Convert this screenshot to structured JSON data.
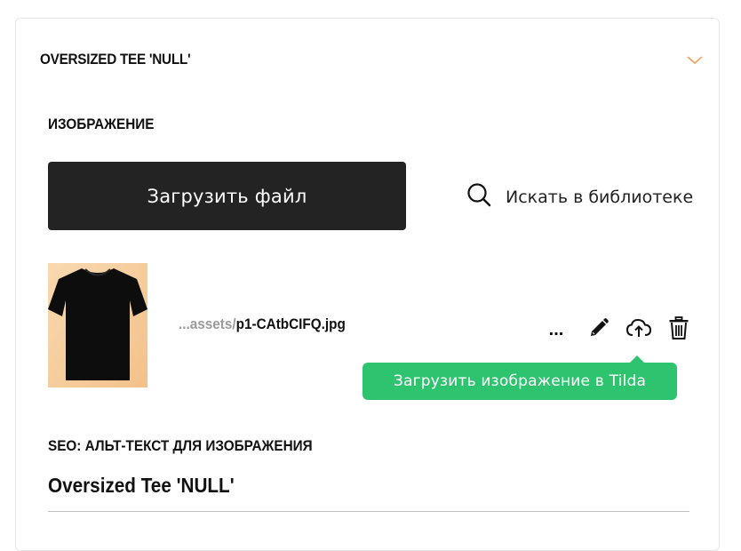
{
  "product": {
    "title": "OVERSIZED TEE 'NULL'",
    "collapse_icon": "chevron-down-icon",
    "accent_color": "#f0a060"
  },
  "image_section": {
    "label": "ИЗОБРАЖЕНИЕ",
    "upload_button_label": "Загрузить файл",
    "search_library_label": "Искать в библиотеке",
    "search_icon": "search-icon"
  },
  "file": {
    "path_prefix": "...assets/",
    "file_name": "p1-CAtbCIFQ.jpg",
    "thumbnail": "black-tshirt-image",
    "actions": {
      "more_label": "...",
      "edit_icon": "pencil-icon",
      "upload_icon": "cloud-upload-icon",
      "delete_icon": "trash-icon"
    }
  },
  "tooltip": {
    "text": "Загрузить изображение в Tilda",
    "color": "#2ec46f"
  },
  "seo": {
    "label": "SEO: АЛЬТ-ТЕКСТ ДЛЯ ИЗОБРАЖЕНИЯ",
    "alt_text_value": "Oversized Tee 'NULL'"
  }
}
